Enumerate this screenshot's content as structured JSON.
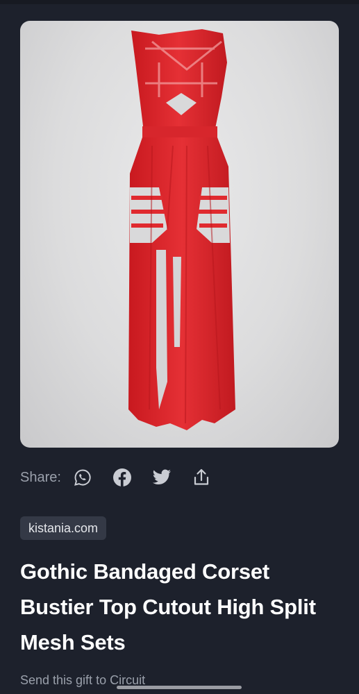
{
  "product": {
    "image_icon": "red-bandaged-corset-dress-photo",
    "title": "Gothic Bandaged Corset Bustier Top Cutout High Split Mesh Sets",
    "source": "kistania.com"
  },
  "share": {
    "label": "Share:",
    "icons": [
      "whatsapp-icon",
      "facebook-icon",
      "twitter-icon",
      "share-upload-icon"
    ]
  },
  "gift": {
    "text": "Send this gift to Circuit"
  },
  "colors": {
    "background": "#1d212c",
    "badge": "#343946",
    "product_red": "#e02a2f",
    "muted_text": "#9aa0ab"
  }
}
